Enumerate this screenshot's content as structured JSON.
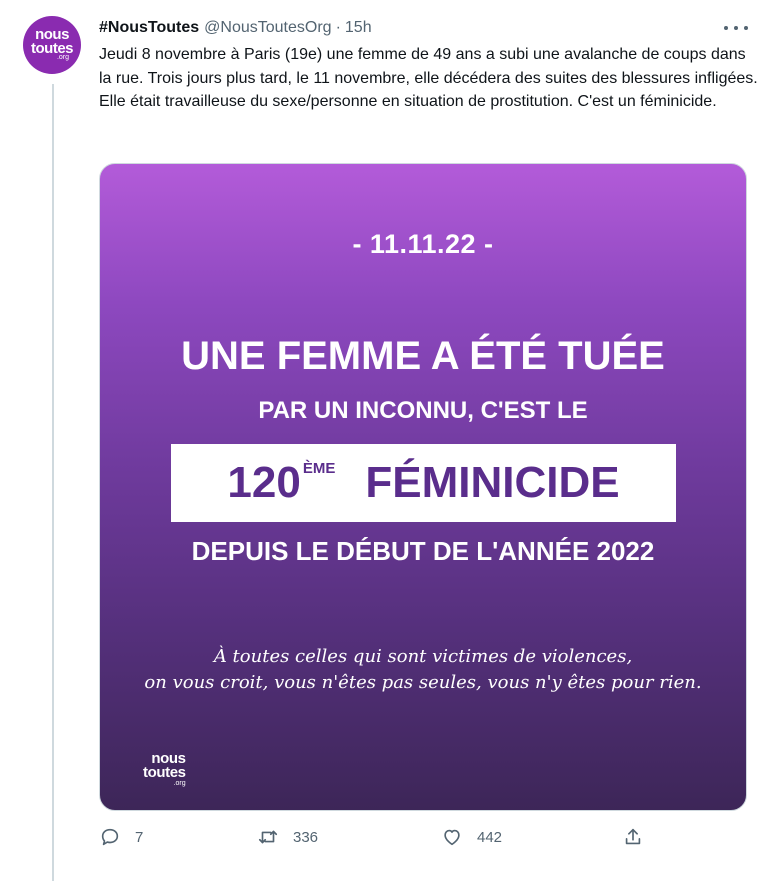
{
  "author": {
    "name": "#NousToutes",
    "handle": "@NousToutesOrg",
    "separator": "·",
    "time": "15h",
    "avatar_line1": "nous",
    "avatar_line2": "toutes",
    "avatar_line3": ".org"
  },
  "tweet": {
    "text": "Jeudi 8 novembre à Paris (19e) une femme de 49 ans a subi une avalanche de coups dans la rue. Trois jours plus tard, le 11 novembre, elle décédera des suites des blessures infligées. Elle était travailleuse du sexe/personne en situation de prostitution. C'est un féminicide."
  },
  "media": {
    "date": "- 11.11.22 -",
    "headline1": "UNE FEMME A ÉTÉ TUÉE",
    "headline2": "PAR UN INCONNU, C'EST LE",
    "count": "120",
    "count_suffix": "ÈME",
    "word": "FÉMINICIDE",
    "headline3": "DEPUIS LE DÉBUT DE L'ANNÉE 2022",
    "quote_line1": "À toutes celles qui sont victimes de violences,",
    "quote_line2": "on vous croit, vous n'êtes pas seules, vous n'y êtes pour rien.",
    "logo_line1": "nous",
    "logo_line2": "toutes",
    "logo_line3": ".org"
  },
  "actions": {
    "replies": "7",
    "retweets": "336",
    "likes": "442"
  },
  "colors": {
    "brand_purple": "#8a2bb0",
    "text_muted": "#536471"
  }
}
